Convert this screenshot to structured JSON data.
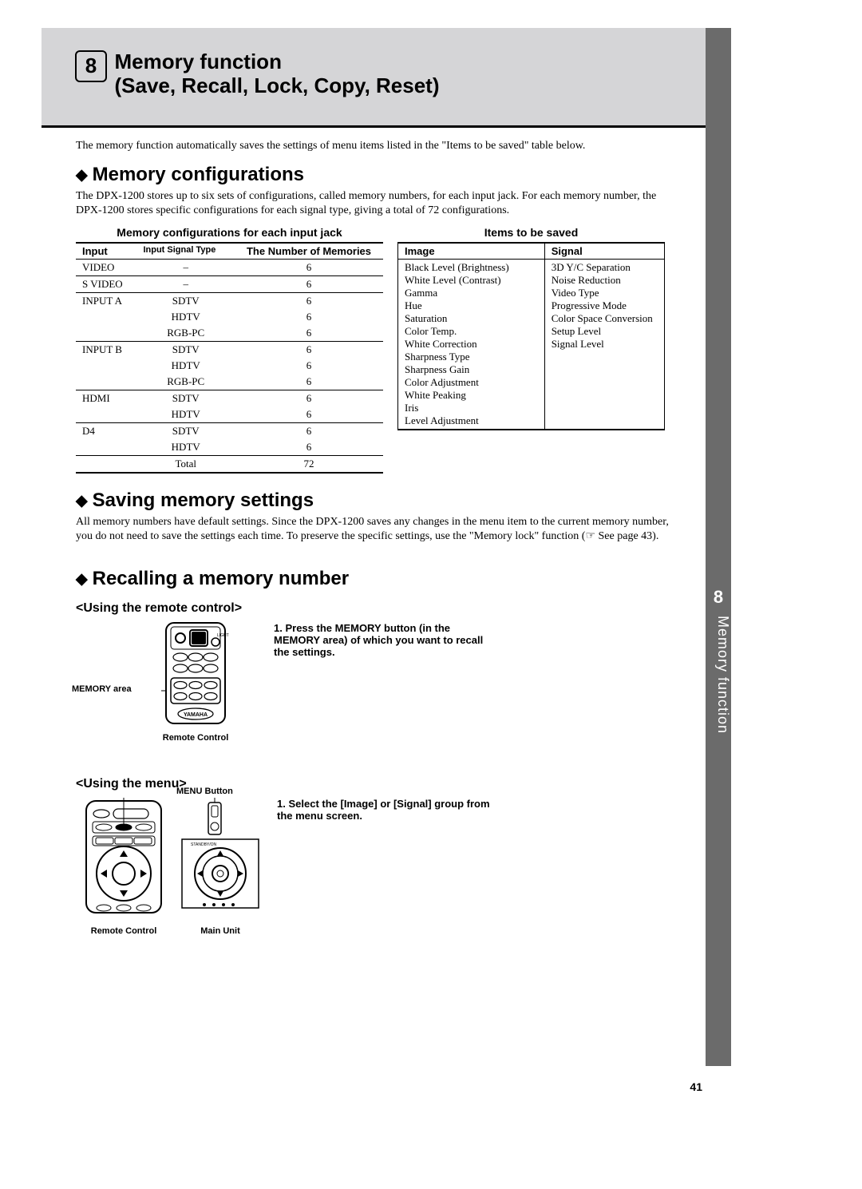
{
  "chapter": {
    "number": "8",
    "title_line1": "Memory function",
    "title_line2": "(Save, Recall, Lock, Copy, Reset)"
  },
  "side_tab": {
    "number": "8",
    "label": "Memory function"
  },
  "intro": "The memory function automatically saves the settings of menu items listed in the \"Items to be saved\" table below.",
  "sections": {
    "memcfg": {
      "heading": "Memory configurations",
      "body": "The DPX-1200 stores up to six sets of configurations, called memory numbers, for each input jack.  For each memory number, the DPX-1200 stores specific configurations for each signal type, giving a total of 72 configurations."
    },
    "saving": {
      "heading": "Saving memory settings",
      "body": "All memory numbers have default settings. Since the DPX-1200 saves any changes in the menu item to the current memory number, you do not need to save the settings each time. To preserve the specific settings, use the \"Memory lock\" function (☞ See page 43)."
    },
    "recall": {
      "heading": "Recalling a memory number",
      "sub_remote": "<Using the remote control>",
      "sub_menu": "<Using the menu>",
      "remote_step1": "Press the MEMORY button (in the MEMORY area) of which you want to recall the settings.",
      "menu_step1": "Select the [Image] or [Signal] group from the menu screen.",
      "memory_area_label": "MEMORY area",
      "remote_caption": "Remote Control",
      "menu_button_label": "MENU Button",
      "main_unit_caption": "Main Unit"
    }
  },
  "tables": {
    "memcfg": {
      "title": "Memory configurations for each input jack",
      "headers": {
        "input": "Input",
        "signal": "Input Signal Type",
        "num": "The Number of Memories"
      },
      "rows": [
        {
          "input": "VIDEO",
          "signal": "–",
          "num": "6",
          "first": true
        },
        {
          "input": "S VIDEO",
          "signal": "–",
          "num": "6",
          "first": true
        },
        {
          "input": "INPUT A",
          "signal": "SDTV",
          "num": "6",
          "first": true
        },
        {
          "input": "",
          "signal": "HDTV",
          "num": "6"
        },
        {
          "input": "",
          "signal": "RGB-PC",
          "num": "6"
        },
        {
          "input": "INPUT B",
          "signal": "SDTV",
          "num": "6",
          "first": true
        },
        {
          "input": "",
          "signal": "HDTV",
          "num": "6"
        },
        {
          "input": "",
          "signal": "RGB-PC",
          "num": "6"
        },
        {
          "input": "HDMI",
          "signal": "SDTV",
          "num": "6",
          "first": true
        },
        {
          "input": "",
          "signal": "HDTV",
          "num": "6"
        },
        {
          "input": "D4",
          "signal": "SDTV",
          "num": "6",
          "first": true
        },
        {
          "input": "",
          "signal": "HDTV",
          "num": "6"
        }
      ],
      "total": {
        "label": "Total",
        "value": "72"
      }
    },
    "items": {
      "title": "Items to be saved",
      "headers": {
        "image": "Image",
        "signal": "Signal"
      },
      "image": [
        "Black Level (Brightness)",
        "White Level (Contrast)",
        "Gamma",
        "Hue",
        "Saturation",
        "Color Temp.",
        "White Correction",
        "Sharpness Type",
        "Sharpness Gain",
        "Color Adjustment",
        "White Peaking",
        "Iris",
        "Level Adjustment"
      ],
      "signal": [
        "3D Y/C Separation",
        "Noise Reduction",
        "Video Type",
        "Progressive Mode",
        "Color Space Conversion",
        "Setup Level",
        "Signal Level"
      ]
    }
  },
  "labels": {
    "step_prefix": "1."
  },
  "page_number": "41",
  "icons": {
    "light_label": "LIGHT"
  }
}
